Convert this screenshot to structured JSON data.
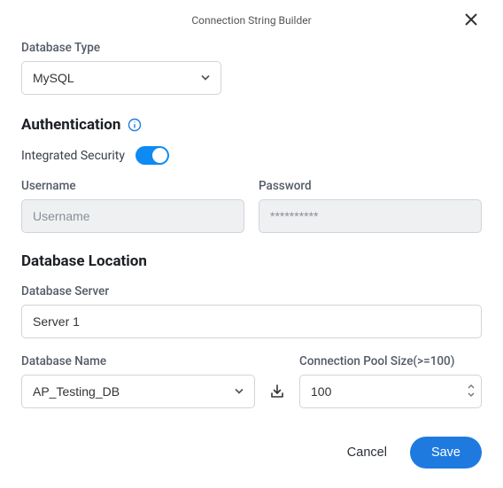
{
  "dialog": {
    "title": "Connection String Builder"
  },
  "database_type": {
    "label": "Database Type",
    "value": "MySQL"
  },
  "authentication": {
    "title": "Authentication",
    "integrated_security": {
      "label": "Integrated Security",
      "enabled": true
    },
    "username": {
      "label": "Username",
      "placeholder": "Username",
      "value": ""
    },
    "password": {
      "label": "Password",
      "value": "**********"
    }
  },
  "location": {
    "title": "Database Location",
    "server": {
      "label": "Database Server",
      "value": "Server 1"
    },
    "database_name": {
      "label": "Database Name",
      "value": "AP_Testing_DB"
    },
    "pool_size": {
      "label": "Connection Pool Size(>=100)",
      "value": "100"
    }
  },
  "footer": {
    "cancel": "Cancel",
    "save": "Save"
  },
  "colors": {
    "primary": "#1f7ae0",
    "toggle": "#0d8bf2"
  }
}
